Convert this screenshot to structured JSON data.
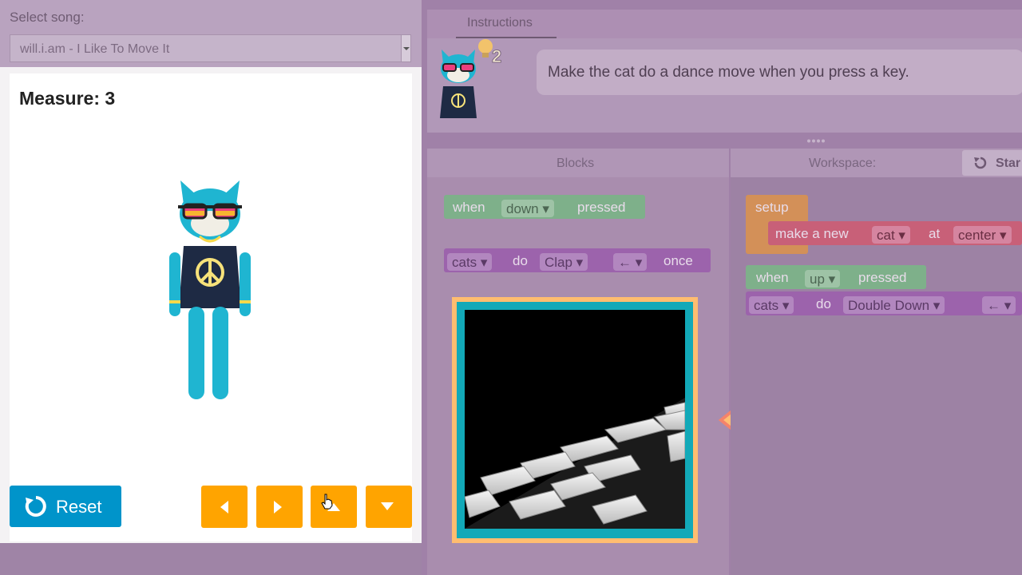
{
  "song": {
    "label": "Select song:",
    "selected": "will.i.am - I Like To Move It"
  },
  "stage": {
    "measure": "Measure: 3"
  },
  "controls": {
    "reset_label": "Reset"
  },
  "instructions": {
    "tab_label": "Instructions",
    "text": "Make the cat do a dance move when you press a key.",
    "hint_count": "2"
  },
  "blocks_panel": {
    "header": "Blocks",
    "block1": {
      "when": "when",
      "key": "down ▾",
      "pressed": "pressed"
    },
    "block2": {
      "target": "cats ▾",
      "do": "do",
      "move": "Clap ▾",
      "dir": "← ▾",
      "once": "once"
    }
  },
  "workspace": {
    "header": "Workspace:",
    "start_label": "Star",
    "setup_label": "setup",
    "make_block": {
      "text": "make a new",
      "kind": "cat ▾",
      "at": "at",
      "pos": "center ▾"
    },
    "when_block": {
      "when": "when",
      "key": "up ▾",
      "pressed": "pressed"
    },
    "do_block": {
      "target": "cats ▾",
      "do": "do",
      "move": "Double Down ▾",
      "dir": "← ▾"
    }
  },
  "colors": {
    "reset": "#0094ca",
    "arrow_buttons": "#ffa400",
    "event_block": "#7eb08a",
    "action_block": "#9c63ac"
  }
}
